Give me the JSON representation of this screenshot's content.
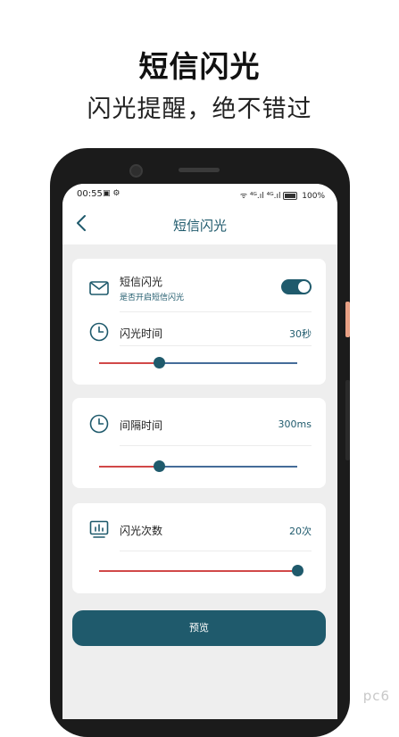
{
  "promo": {
    "title": "短信闪光",
    "subtitle": "闪光提醒，绝不错过"
  },
  "status_bar": {
    "time": "00:55",
    "signal_text": "ᯤ ⁴ᴳ.ıl ⁴ᴳ.ıl",
    "battery": "100%"
  },
  "app_bar": {
    "title": "短信闪光",
    "back_icon": "chevron-left-icon"
  },
  "sms_flash": {
    "label": "短信闪光",
    "sublabel": "是否开启短信闪光",
    "enabled": true,
    "icon": "envelope-icon"
  },
  "flash_duration": {
    "label": "闪光时间",
    "value": "30秒",
    "level": 0.3,
    "icon": "clock-icon"
  },
  "interval": {
    "label": "间隔时间",
    "value": "300ms",
    "level": 0.3,
    "icon": "clock-icon"
  },
  "flash_count": {
    "label": "闪光次数",
    "value": "20次",
    "level": 1.0,
    "icon": "chart-monitor-icon"
  },
  "preview_button": {
    "label": "预览"
  },
  "watermark": "pc6",
  "colors": {
    "accent": "#1f5a6c",
    "slider_active": "#d14848",
    "slider_inactive": "#456c99"
  }
}
